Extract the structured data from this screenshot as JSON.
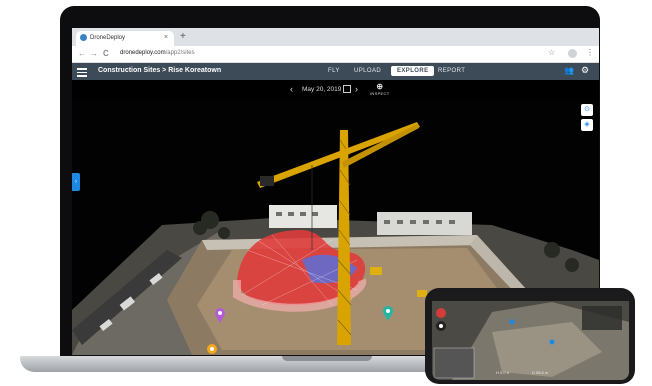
{
  "browser": {
    "tab_title": "DroneDeploy",
    "tab_close": "×",
    "new_tab": "+",
    "url_domain": "dronedeploy.com",
    "url_path": "/app2/sites",
    "back": "←",
    "forward": "→",
    "reload": "C",
    "star": "☆",
    "menu": "⋮"
  },
  "app": {
    "breadcrumb": "Construction Sites > Rise Koreatown",
    "tabs": [
      "FLY",
      "UPLOAD",
      "EXPLORE",
      "REPORT"
    ],
    "active_tab": "EXPLORE",
    "users_icon": "👥",
    "settings_icon": "⚙"
  },
  "datebar": {
    "prev": "‹",
    "date": "May 20, 2019",
    "next": "›",
    "inspect_label": "INSPECT",
    "inspect_icon": "⊕"
  },
  "side_toggle": "›",
  "map_controls": {
    "fit": "⊙",
    "layers": "◈"
  },
  "phone": {
    "stat_line": "H 0.0 ft",
    "distance": "D 58.6 m"
  },
  "colors": {
    "header_bg": "#3d4a58",
    "accent": "#1e88e5",
    "overlay_red": "#e03a3a",
    "overlay_blue": "#5b6fd8",
    "crane_yellow": "#d9a300",
    "marker_purple": "#b45ad6",
    "marker_teal": "#23b5a4",
    "marker_orange": "#f2a71b"
  }
}
